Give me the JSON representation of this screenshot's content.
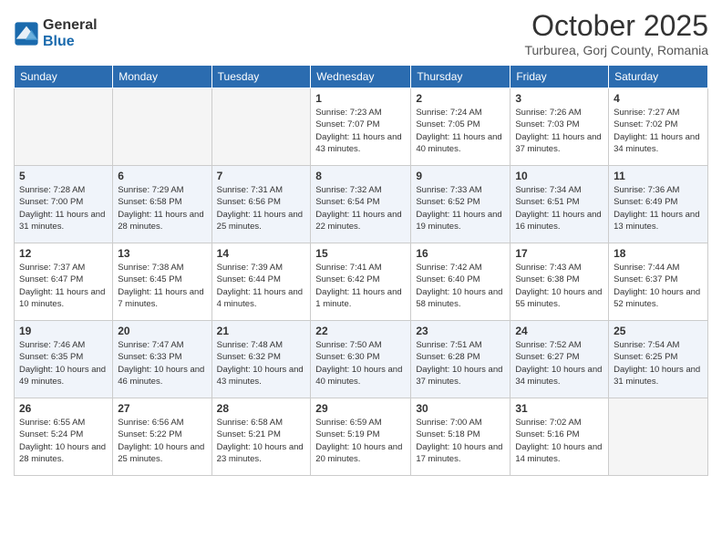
{
  "logo": {
    "general": "General",
    "blue": "Blue"
  },
  "header": {
    "month": "October 2025",
    "location": "Turburea, Gorj County, Romania"
  },
  "weekdays": [
    "Sunday",
    "Monday",
    "Tuesday",
    "Wednesday",
    "Thursday",
    "Friday",
    "Saturday"
  ],
  "weeks": [
    [
      {
        "day": "",
        "info": ""
      },
      {
        "day": "",
        "info": ""
      },
      {
        "day": "",
        "info": ""
      },
      {
        "day": "1",
        "info": "Sunrise: 7:23 AM\nSunset: 7:07 PM\nDaylight: 11 hours and 43 minutes."
      },
      {
        "day": "2",
        "info": "Sunrise: 7:24 AM\nSunset: 7:05 PM\nDaylight: 11 hours and 40 minutes."
      },
      {
        "day": "3",
        "info": "Sunrise: 7:26 AM\nSunset: 7:03 PM\nDaylight: 11 hours and 37 minutes."
      },
      {
        "day": "4",
        "info": "Sunrise: 7:27 AM\nSunset: 7:02 PM\nDaylight: 11 hours and 34 minutes."
      }
    ],
    [
      {
        "day": "5",
        "info": "Sunrise: 7:28 AM\nSunset: 7:00 PM\nDaylight: 11 hours and 31 minutes."
      },
      {
        "day": "6",
        "info": "Sunrise: 7:29 AM\nSunset: 6:58 PM\nDaylight: 11 hours and 28 minutes."
      },
      {
        "day": "7",
        "info": "Sunrise: 7:31 AM\nSunset: 6:56 PM\nDaylight: 11 hours and 25 minutes."
      },
      {
        "day": "8",
        "info": "Sunrise: 7:32 AM\nSunset: 6:54 PM\nDaylight: 11 hours and 22 minutes."
      },
      {
        "day": "9",
        "info": "Sunrise: 7:33 AM\nSunset: 6:52 PM\nDaylight: 11 hours and 19 minutes."
      },
      {
        "day": "10",
        "info": "Sunrise: 7:34 AM\nSunset: 6:51 PM\nDaylight: 11 hours and 16 minutes."
      },
      {
        "day": "11",
        "info": "Sunrise: 7:36 AM\nSunset: 6:49 PM\nDaylight: 11 hours and 13 minutes."
      }
    ],
    [
      {
        "day": "12",
        "info": "Sunrise: 7:37 AM\nSunset: 6:47 PM\nDaylight: 11 hours and 10 minutes."
      },
      {
        "day": "13",
        "info": "Sunrise: 7:38 AM\nSunset: 6:45 PM\nDaylight: 11 hours and 7 minutes."
      },
      {
        "day": "14",
        "info": "Sunrise: 7:39 AM\nSunset: 6:44 PM\nDaylight: 11 hours and 4 minutes."
      },
      {
        "day": "15",
        "info": "Sunrise: 7:41 AM\nSunset: 6:42 PM\nDaylight: 11 hours and 1 minute."
      },
      {
        "day": "16",
        "info": "Sunrise: 7:42 AM\nSunset: 6:40 PM\nDaylight: 10 hours and 58 minutes."
      },
      {
        "day": "17",
        "info": "Sunrise: 7:43 AM\nSunset: 6:38 PM\nDaylight: 10 hours and 55 minutes."
      },
      {
        "day": "18",
        "info": "Sunrise: 7:44 AM\nSunset: 6:37 PM\nDaylight: 10 hours and 52 minutes."
      }
    ],
    [
      {
        "day": "19",
        "info": "Sunrise: 7:46 AM\nSunset: 6:35 PM\nDaylight: 10 hours and 49 minutes."
      },
      {
        "day": "20",
        "info": "Sunrise: 7:47 AM\nSunset: 6:33 PM\nDaylight: 10 hours and 46 minutes."
      },
      {
        "day": "21",
        "info": "Sunrise: 7:48 AM\nSunset: 6:32 PM\nDaylight: 10 hours and 43 minutes."
      },
      {
        "day": "22",
        "info": "Sunrise: 7:50 AM\nSunset: 6:30 PM\nDaylight: 10 hours and 40 minutes."
      },
      {
        "day": "23",
        "info": "Sunrise: 7:51 AM\nSunset: 6:28 PM\nDaylight: 10 hours and 37 minutes."
      },
      {
        "day": "24",
        "info": "Sunrise: 7:52 AM\nSunset: 6:27 PM\nDaylight: 10 hours and 34 minutes."
      },
      {
        "day": "25",
        "info": "Sunrise: 7:54 AM\nSunset: 6:25 PM\nDaylight: 10 hours and 31 minutes."
      }
    ],
    [
      {
        "day": "26",
        "info": "Sunrise: 6:55 AM\nSunset: 5:24 PM\nDaylight: 10 hours and 28 minutes."
      },
      {
        "day": "27",
        "info": "Sunrise: 6:56 AM\nSunset: 5:22 PM\nDaylight: 10 hours and 25 minutes."
      },
      {
        "day": "28",
        "info": "Sunrise: 6:58 AM\nSunset: 5:21 PM\nDaylight: 10 hours and 23 minutes."
      },
      {
        "day": "29",
        "info": "Sunrise: 6:59 AM\nSunset: 5:19 PM\nDaylight: 10 hours and 20 minutes."
      },
      {
        "day": "30",
        "info": "Sunrise: 7:00 AM\nSunset: 5:18 PM\nDaylight: 10 hours and 17 minutes."
      },
      {
        "day": "31",
        "info": "Sunrise: 7:02 AM\nSunset: 5:16 PM\nDaylight: 10 hours and 14 minutes."
      },
      {
        "day": "",
        "info": ""
      }
    ]
  ]
}
